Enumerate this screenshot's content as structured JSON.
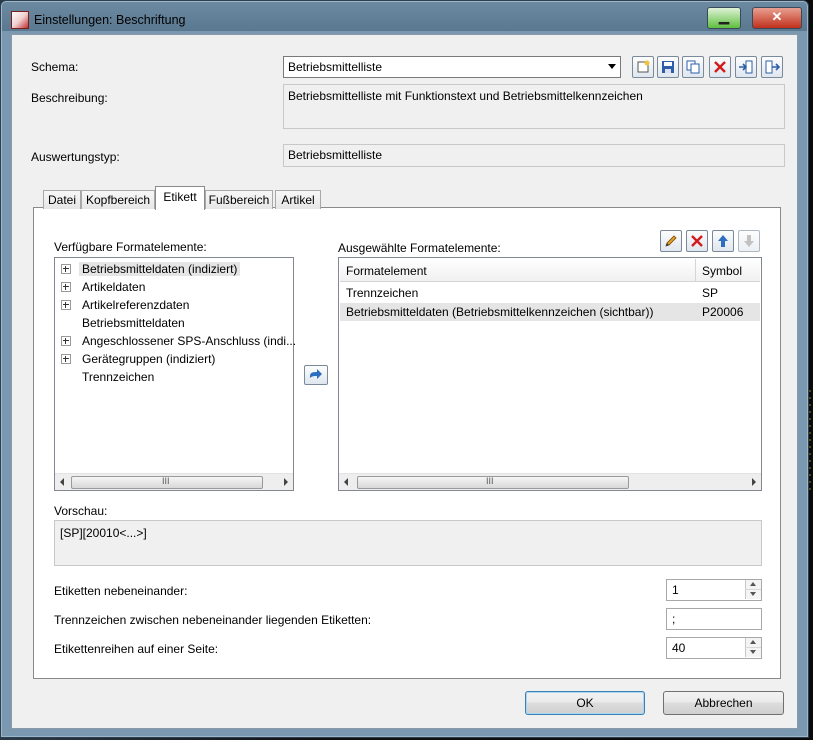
{
  "window": {
    "title": "Einstellungen: Beschriftung"
  },
  "schema": {
    "label": "Schema:",
    "value": "Betriebsmittelliste"
  },
  "description": {
    "label": "Beschreibung:",
    "value": "Betriebsmittelliste mit Funktionstext und Betriebsmittelkennzeichen"
  },
  "evaluation_type": {
    "label": "Auswertungstyp:",
    "value": "Betriebsmittelliste"
  },
  "tabs": [
    {
      "label": "Datei"
    },
    {
      "label": "Kopfbereich"
    },
    {
      "label": "Etikett",
      "active": true
    },
    {
      "label": "Fußbereich"
    },
    {
      "label": "Artikel"
    }
  ],
  "available": {
    "label": "Verfügbare Formatelemente:",
    "items": [
      {
        "label": "Betriebsmitteldaten (indiziert)",
        "expandable": true,
        "selected": true
      },
      {
        "label": "Artikeldaten",
        "expandable": true
      },
      {
        "label": "Artikelreferenzdaten",
        "expandable": true
      },
      {
        "label": "Betriebsmitteldaten",
        "expandable": false
      },
      {
        "label": "Angeschlossener SPS-Anschluss (indi...",
        "expandable": true
      },
      {
        "label": "Gerätegruppen (indiziert)",
        "expandable": true
      },
      {
        "label": "Trennzeichen",
        "expandable": false
      }
    ]
  },
  "selected": {
    "label": "Ausgewählte Formatelemente:",
    "columns": [
      "Formatelement",
      "Symbol"
    ],
    "rows": [
      {
        "element": "Trennzeichen",
        "symbol": "SP"
      },
      {
        "element": "Betriebsmitteldaten (Betriebsmittelkennzeichen (sichtbar))",
        "symbol": "P20006",
        "selected": true
      }
    ]
  },
  "preview": {
    "label": "Vorschau:",
    "value": "[SP][20010<...>]"
  },
  "settings": {
    "labels_side_by_side": {
      "label": "Etiketten nebeneinander:",
      "value": "1"
    },
    "separator": {
      "label": "Trennzeichen zwischen nebeneinander liegenden Etiketten:",
      "value": ";"
    },
    "rows_per_page": {
      "label": "Etikettenreihen auf einer Seite:",
      "value": "40"
    }
  },
  "buttons": {
    "ok": "OK",
    "cancel": "Abbrechen"
  },
  "scroll_grip": "III",
  "colors": {
    "accent": "#3c7fb1",
    "selection": "#e5e5e5",
    "close_red": "#c0301c"
  }
}
